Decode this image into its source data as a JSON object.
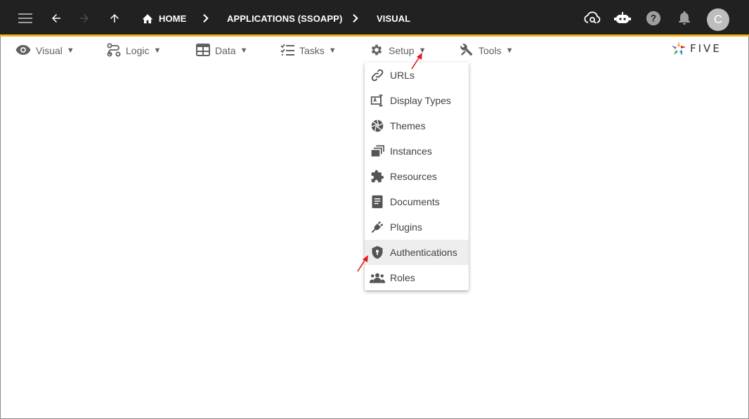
{
  "topbar": {
    "breadcrumbs": [
      "HOME",
      "APPLICATIONS (SSOAPP)",
      "VISUAL"
    ],
    "avatar_initial": "C"
  },
  "menubar": {
    "items": [
      {
        "label": "Visual",
        "icon": "eye-icon"
      },
      {
        "label": "Logic",
        "icon": "flow-icon"
      },
      {
        "label": "Data",
        "icon": "table-icon"
      },
      {
        "label": "Tasks",
        "icon": "checklist-icon"
      },
      {
        "label": "Setup",
        "icon": "gear-icon"
      },
      {
        "label": "Tools",
        "icon": "tools-icon"
      }
    ],
    "caret": "▼",
    "logo_text": "FIVE"
  },
  "setup_menu": {
    "items": [
      {
        "label": "URLs",
        "icon": "link-icon"
      },
      {
        "label": "Display Types",
        "icon": "display-type-icon"
      },
      {
        "label": "Themes",
        "icon": "aperture-icon"
      },
      {
        "label": "Instances",
        "icon": "instances-icon"
      },
      {
        "label": "Resources",
        "icon": "puzzle-icon"
      },
      {
        "label": "Documents",
        "icon": "document-icon"
      },
      {
        "label": "Plugins",
        "icon": "plug-icon"
      },
      {
        "label": "Authentications",
        "icon": "shield-icon",
        "highlighted": true
      },
      {
        "label": "Roles",
        "icon": "people-icon"
      }
    ]
  },
  "colors": {
    "topbar_bg": "#212121",
    "accent": "#f2b21a",
    "annotation_arrow": "#e8191a"
  }
}
